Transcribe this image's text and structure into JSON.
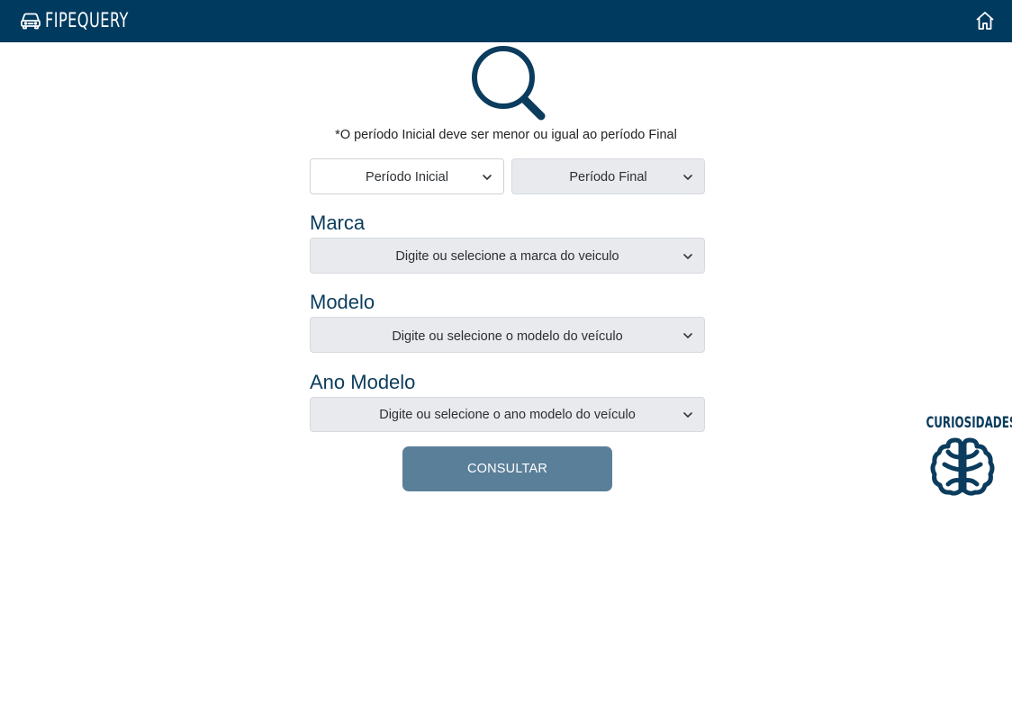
{
  "header": {
    "brand": "FIPEQUERY",
    "background": "#013a5f",
    "icons": {
      "logo": "car-icon",
      "home": "home-icon"
    }
  },
  "hero": {
    "icon": "search-icon",
    "color": "#0b3c5d"
  },
  "notice": "*O período Inicial deve ser menor ou igual ao período Final",
  "periods": {
    "initial_placeholder": "Período Inicial",
    "final_placeholder": "Período Final"
  },
  "marca": {
    "label": "Marca",
    "placeholder": "Digite ou selecione a marca do veiculo"
  },
  "modelo": {
    "label": "Modelo",
    "placeholder": "Digite ou selecione o modelo do veículo"
  },
  "ano": {
    "label": "Ano Modelo",
    "placeholder": "Digite ou selecione o ano modelo do veículo"
  },
  "submit": {
    "label": "CONSULTAR",
    "color": "#5a7f99"
  },
  "curiosidades": {
    "label": "CURIOSIDADES",
    "icon": "brain-icon",
    "color": "#0b3c5d"
  }
}
